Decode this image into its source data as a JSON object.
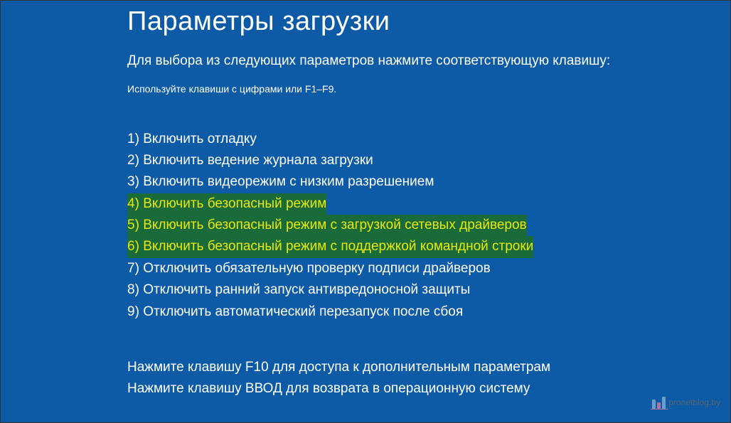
{
  "title": "Параметры загрузки",
  "subtitle": "Для выбора из следующих параметров нажмите соответствующую клавишу:",
  "hint": "Используйте клавиши с цифрами или F1–F9.",
  "options": [
    {
      "num": "1)",
      "label": "Включить отладку",
      "highlighted": false
    },
    {
      "num": "2)",
      "label": "Включить ведение журнала загрузки",
      "highlighted": false
    },
    {
      "num": "3)",
      "label": "Включить видеорежим с низким разрешением",
      "highlighted": false
    },
    {
      "num": "4)",
      "label": "Включить безопасный режим",
      "highlighted": true
    },
    {
      "num": "5)",
      "label": "Включить безопасный режим с загрузкой сетевых драйверов",
      "highlighted": true
    },
    {
      "num": "6)",
      "label": "Включить безопасный режим с поддержкой командной строки",
      "highlighted": true
    },
    {
      "num": "7)",
      "label": "Отключить обязательную проверку подписи драйверов",
      "highlighted": false
    },
    {
      "num": "8)",
      "label": "Отключить ранний запуск антивредоносной защиты",
      "highlighted": false
    },
    {
      "num": "9)",
      "label": "Отключить автоматический перезапуск после сбоя",
      "highlighted": false
    }
  ],
  "footer_line1": "Нажмите клавишу F10 для доступа к дополнительным параметрам",
  "footer_line2": "Нажмите клавишу ВВОД для возврата в операционную систему",
  "watermark": {
    "domain": "pronetblog.by"
  }
}
